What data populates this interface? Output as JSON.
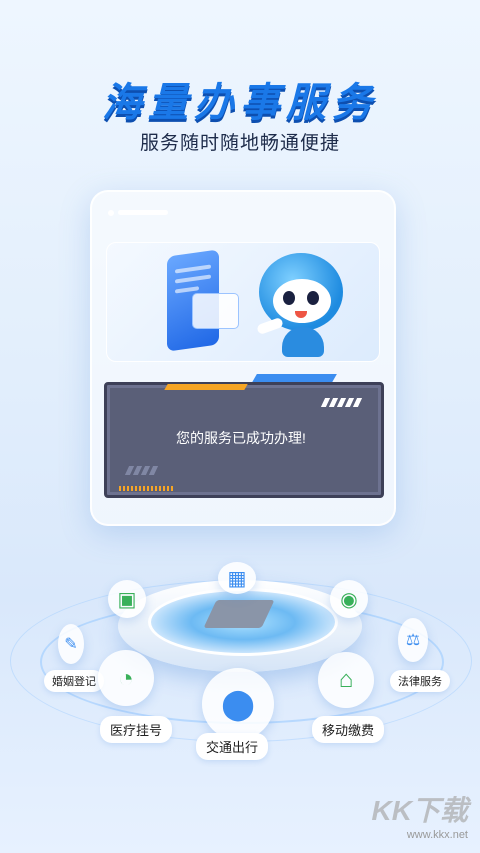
{
  "header": {
    "title": "海量办事服务",
    "subtitle": "服务随时随地畅通便捷"
  },
  "dialog": {
    "message": "您的服务已成功办理!"
  },
  "services": [
    {
      "label": "婚姻登记",
      "icon": "pen-icon"
    },
    {
      "label": "医疗挂号",
      "icon": "chart-icon"
    },
    {
      "label": "交通出行",
      "icon": "location-pin-icon"
    },
    {
      "label": "移动缴费",
      "icon": "house-icon"
    },
    {
      "label": "法律服务",
      "icon": "scale-icon"
    }
  ],
  "watermark": {
    "logo": "KK下载",
    "url": "www.kkx.net"
  },
  "colors": {
    "title_blue": "#1a78e8",
    "dialog_bg": "#5a5f78",
    "accent_orange": "#f6a524",
    "green": "#39b05a"
  }
}
